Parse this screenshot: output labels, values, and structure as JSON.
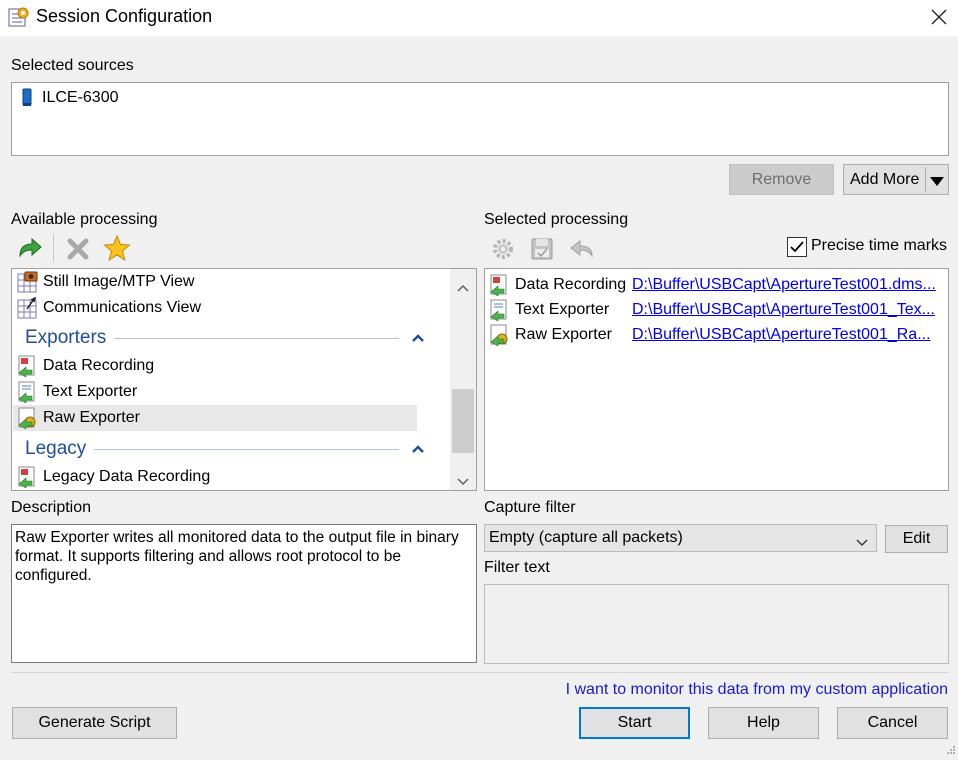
{
  "window": {
    "title": "Session Configuration"
  },
  "sources": {
    "label": "Selected sources",
    "items": [
      {
        "name": "ILCE-6300"
      }
    ],
    "remove_label": "Remove",
    "add_more_label": "Add More"
  },
  "available": {
    "label": "Available processing",
    "items_top": [
      {
        "name": "Still Image/MTP View"
      },
      {
        "name": "Communications View"
      }
    ],
    "groups": [
      {
        "title": "Exporters",
        "items": [
          "Data Recording",
          "Text Exporter",
          "Raw Exporter"
        ]
      },
      {
        "title": "Legacy",
        "items": [
          "Legacy Data Recording"
        ]
      }
    ]
  },
  "selected": {
    "label": "Selected processing",
    "precise_label": "Precise time marks",
    "precise_checked": true,
    "rows": [
      {
        "name": "Data Recording",
        "path": "D:\\Buffer\\USBCapt\\ApertureTest001.dms..."
      },
      {
        "name": "Text Exporter",
        "path": "D:\\Buffer\\USBCapt\\ApertureTest001_Tex..."
      },
      {
        "name": "Raw Exporter",
        "path": "D:\\Buffer\\USBCapt\\ApertureTest001_Ra..."
      }
    ]
  },
  "description": {
    "label": "Description",
    "text": "Raw Exporter writes all monitored data to the output file in binary format. It supports filtering and allows root protocol to be configured."
  },
  "capture": {
    "label": "Capture filter",
    "value": "Empty (capture all packets)",
    "edit_label": "Edit",
    "filter_text_label": "Filter text",
    "filter_text": ""
  },
  "footer": {
    "link": "I want to monitor this data from my custom application",
    "generate_label": "Generate Script",
    "start_label": "Start",
    "help_label": "Help",
    "cancel_label": "Cancel"
  }
}
